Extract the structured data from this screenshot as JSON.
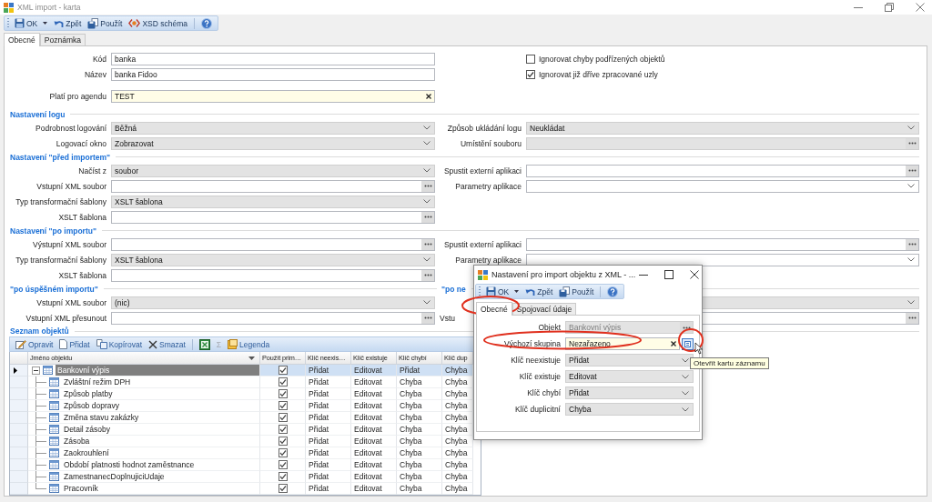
{
  "window": {
    "title": "XML import - karta"
  },
  "toolbar": [
    {
      "label": "OK",
      "kind": "save",
      "menu": true
    },
    {
      "label": "Zpět",
      "kind": "undo",
      "menu": false
    },
    {
      "label": "Použít",
      "kind": "apply",
      "menu": false
    },
    {
      "label": "XSD schéma",
      "kind": "schema",
      "menu": false
    },
    {
      "kind": "help",
      "menu": false
    }
  ],
  "tabs": [
    {
      "label": "Obecné",
      "selected": true
    },
    {
      "label": "Poznámka",
      "selected": false
    }
  ],
  "header_fields": [
    {
      "label": "Kód",
      "value": "banka",
      "kind": "text"
    },
    {
      "label": "Název",
      "value": "banka Fidoo",
      "kind": "text"
    },
    {
      "label": "Platí pro agendu",
      "value": "TEST",
      "kind": "lookup"
    }
  ],
  "options": [
    {
      "label": "Ignorovat chyby podřízených objektů",
      "checked": false
    },
    {
      "label": "Ignorovat již dříve zpracované uzly",
      "checked": true
    }
  ],
  "sections": [
    {
      "title": "Nastavení logu",
      "rows": [
        {
          "left": {
            "label": "Podrobnost logování",
            "value": "Běžná",
            "kind": "select"
          },
          "right": {
            "label": "Způsob ukládání logu",
            "value": "Neukládat",
            "kind": "select"
          }
        },
        {
          "left": {
            "label": "Logovací okno",
            "value": "Zobrazovat",
            "kind": "select"
          },
          "right": {
            "label": "Umístění souboru",
            "kind": "browse-locked"
          }
        }
      ]
    },
    {
      "title": "Nastavení \"před importem\"",
      "rows": [
        {
          "left": {
            "label": "Načíst z",
            "value": "soubor",
            "kind": "select"
          },
          "right": {
            "label": "Spustit externí aplikaci",
            "kind": "browse"
          }
        },
        {
          "left": {
            "label": "Vstupní XML soubor",
            "kind": "browse"
          },
          "right": {
            "label": "Parametry aplikace",
            "kind": "combo"
          }
        },
        {
          "left": {
            "label": "Typ transformační šablony",
            "value": "XSLT šablona",
            "kind": "select"
          }
        },
        {
          "left": {
            "label": "XSLT šablona",
            "kind": "browse"
          }
        }
      ]
    },
    {
      "title": "Nastavení \"po importu\"",
      "rows": [
        {
          "left": {
            "label": "Výstupní XML soubor",
            "kind": "browse"
          },
          "right": {
            "label": "Spustit externí aplikaci",
            "kind": "browse"
          }
        },
        {
          "left": {
            "label": "Typ transformační šablony",
            "value": "XSLT šablona",
            "kind": "select"
          },
          "right": {
            "label": "Parametry aplikace",
            "kind": "combo"
          }
        },
        {
          "left": {
            "label": "XSLT šablona",
            "kind": "browse"
          }
        }
      ]
    },
    {
      "title": "\"po úspěšném importu\"",
      "right_title": "\"po ne",
      "rows": [
        {
          "left": {
            "label": "Vstupní XML soubor",
            "value": "(nic)",
            "kind": "select"
          },
          "right": {
            "kind": "select"
          }
        },
        {
          "left": {
            "label": "Vstupní XML přesunout",
            "kind": "browse"
          },
          "right": {
            "label": "Vstu",
            "kind": "browse"
          }
        }
      ]
    }
  ],
  "grid": {
    "title": "Seznam objektů",
    "toolbar": [
      {
        "label": "Opravit",
        "kind": "edit",
        "disabled": false
      },
      {
        "label": "Přidat",
        "kind": "new",
        "disabled": false
      },
      {
        "label": "Kopírovat",
        "kind": "copy",
        "disabled": false
      },
      {
        "label": "Smazat",
        "kind": "delete",
        "disabled": false
      },
      {
        "kind": "excel",
        "disabled": false
      },
      {
        "label": "Σ",
        "kind": "sum",
        "disabled": true
      },
      {
        "label": "Legenda",
        "kind": "legend",
        "disabled": false
      }
    ],
    "columns": [
      "Jméno objektu",
      "Použít prim…",
      "Klíč neexis…",
      "Klíč existuje",
      "Klíč chybí",
      "Klíč dup"
    ],
    "rows": [
      {
        "name": "Bankovní výpis",
        "selected": true,
        "expanded": true,
        "use_primary": true,
        "key_not_exists": "Přidat",
        "key_exists": "Editovat",
        "key_missing": "Přidat",
        "column_7": "Chyba",
        "children": [
          {
            "name": "Zvláštní režim DPH",
            "selected": false,
            "use_primary": true,
            "key_not_exists": "Přidat",
            "key_exists": "Editovat",
            "key_missing": "Chyba",
            "column_7": "Chyba"
          },
          {
            "name": "Způsob platby",
            "selected": false,
            "use_primary": true,
            "key_not_exists": "Přidat",
            "key_exists": "Editovat",
            "key_missing": "Chyba",
            "column_7": "Chyba"
          },
          {
            "name": "Způsob dopravy",
            "selected": false,
            "use_primary": true,
            "key_not_exists": "Přidat",
            "key_exists": "Editovat",
            "key_missing": "Chyba",
            "column_7": "Chyba"
          },
          {
            "name": "Změna stavu zakázky",
            "selected": false,
            "use_primary": true,
            "key_not_exists": "Přidat",
            "key_exists": "Editovat",
            "key_missing": "Chyba",
            "column_7": "Chyba"
          },
          {
            "name": "Detail zásoby",
            "selected": false,
            "use_primary": true,
            "key_not_exists": "Přidat",
            "key_exists": "Editovat",
            "key_missing": "Chyba",
            "column_7": "Chyba"
          },
          {
            "name": "Zásoba",
            "selected": false,
            "use_primary": true,
            "key_not_exists": "Přidat",
            "key_exists": "Editovat",
            "key_missing": "Chyba",
            "column_7": "Chyba"
          },
          {
            "name": "Zaokrouhlení",
            "selected": false,
            "use_primary": true,
            "key_not_exists": "Přidat",
            "key_exists": "Editovat",
            "key_missing": "Chyba",
            "column_7": "Chyba"
          },
          {
            "name": "Období platnosti hodnot zaměstnance",
            "selected": false,
            "use_primary": true,
            "key_not_exists": "Přidat",
            "key_exists": "Editovat",
            "key_missing": "Chyba",
            "column_7": "Chyba"
          },
          {
            "name": "ZamestnanecDoplnujiciUdaje",
            "selected": false,
            "use_primary": true,
            "key_not_exists": "Přidat",
            "key_exists": "Editovat",
            "key_missing": "Chyba",
            "column_7": "Chyba"
          },
          {
            "name": "Pracovník",
            "selected": false,
            "use_primary": true,
            "key_not_exists": "Přidat",
            "key_exists": "Editovat",
            "key_missing": "Chyba",
            "column_7": "Chyba"
          }
        ]
      }
    ]
  },
  "dialog": {
    "title": "Nastavení pro import objektu z XML - ...",
    "toolbar": [
      {
        "label": "OK",
        "kind": "save",
        "menu": true
      },
      {
        "label": "Zpět",
        "kind": "undo",
        "menu": false
      },
      {
        "label": "Použít",
        "kind": "apply",
        "menu": false
      },
      {
        "kind": "help",
        "menu": false
      }
    ],
    "tabs": [
      {
        "label": "Obecné",
        "selected": true
      },
      {
        "label": "Spojovací údaje",
        "selected": false
      }
    ],
    "fields": [
      {
        "label": "Objekt",
        "value": "Bankovní výpis",
        "kind": "browse-locked"
      },
      {
        "label": "Výchozí skupina",
        "value": "Nezařazeno",
        "kind": "lookup-card"
      },
      {
        "label": "Klíč neexistuje",
        "value": "Přidat",
        "kind": "select"
      },
      {
        "label": "Klíč existuje",
        "value": "Editovat",
        "kind": "select"
      },
      {
        "label": "Klíč chybí",
        "value": "Přidat",
        "kind": "select"
      },
      {
        "label": "Klíč duplicitní",
        "value": "Chyba",
        "kind": "select"
      }
    ],
    "tooltip": "Otevřít kartu záznamu"
  }
}
